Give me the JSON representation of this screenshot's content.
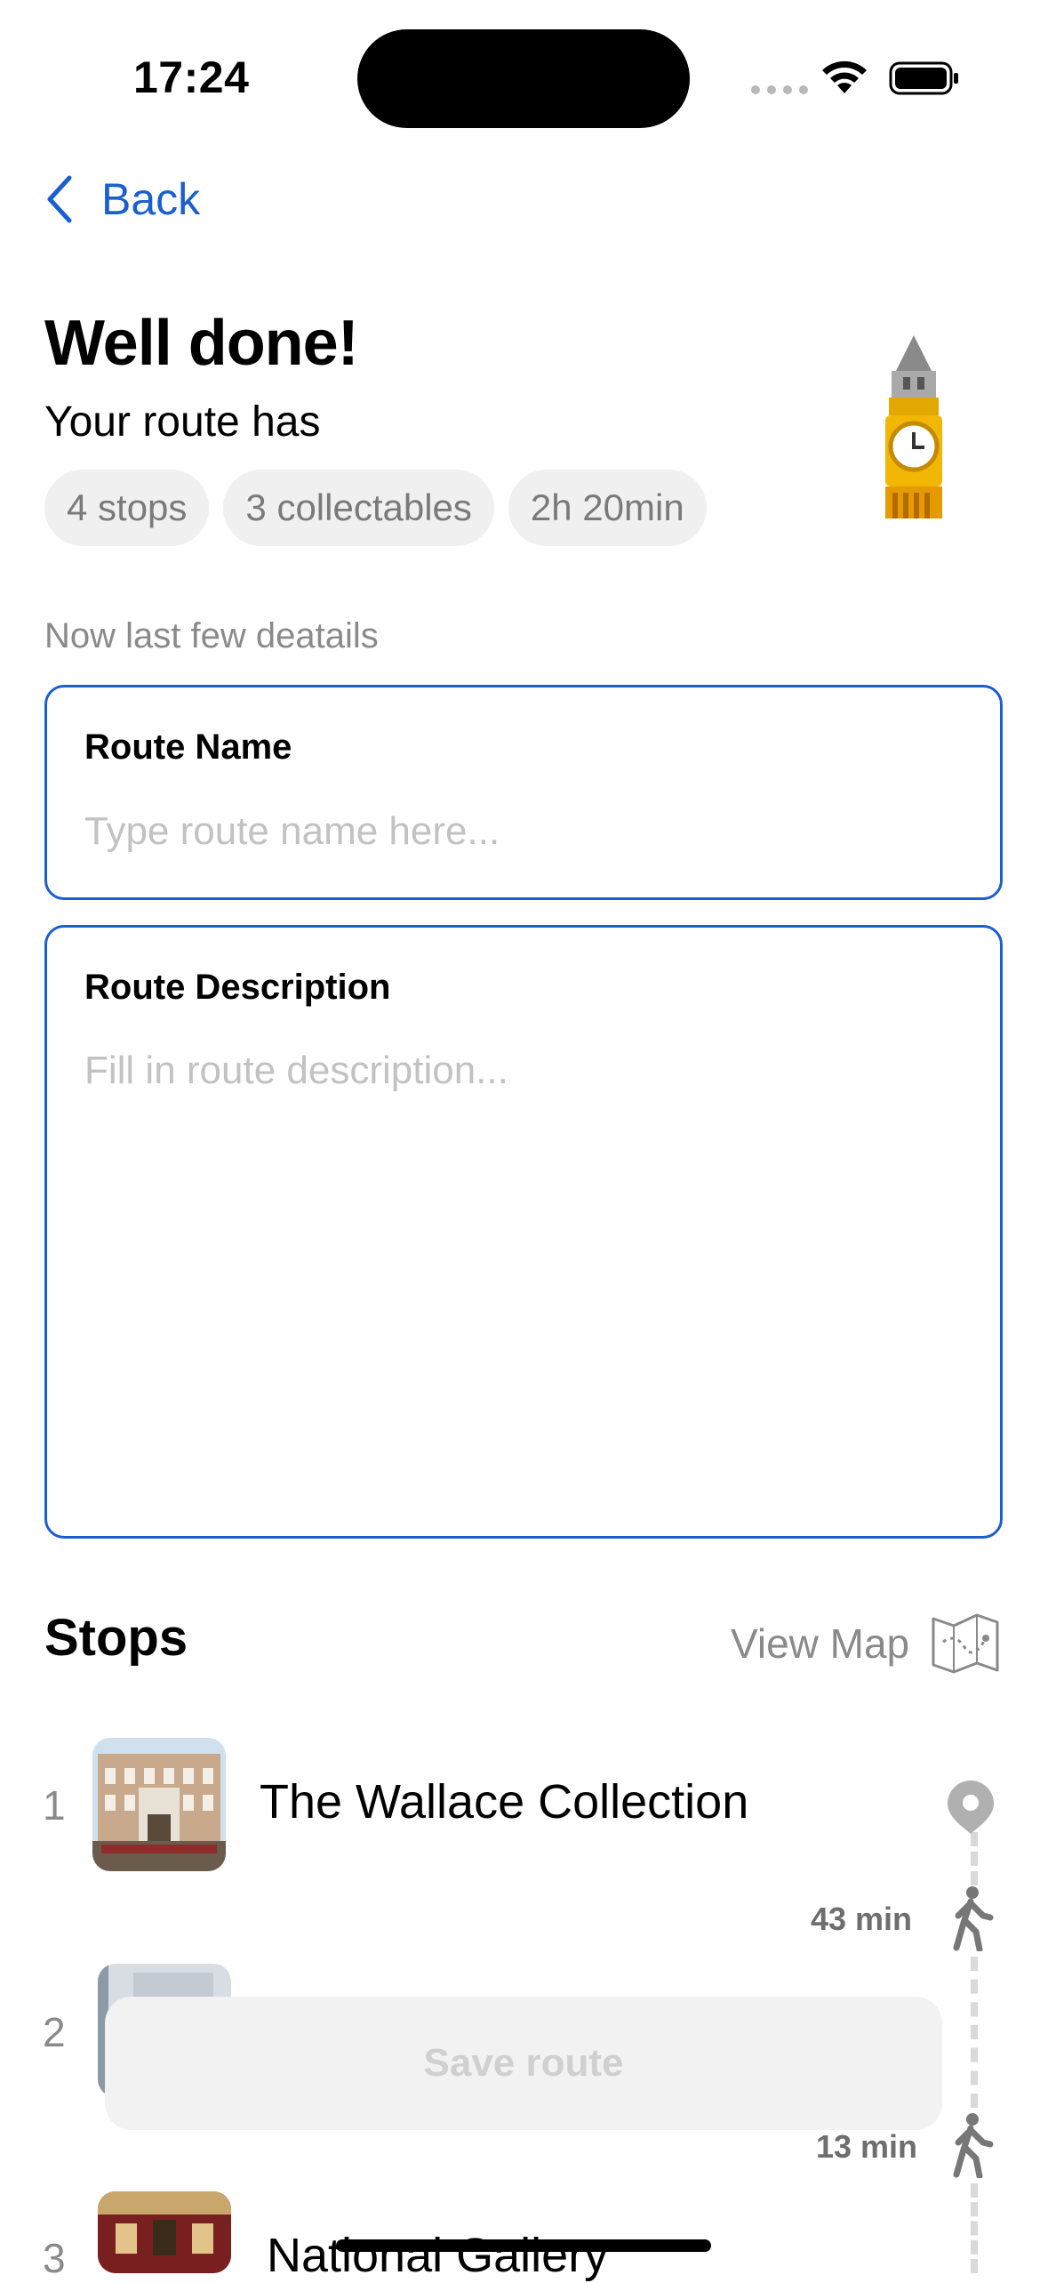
{
  "status_bar": {
    "time": "17:24"
  },
  "nav": {
    "back_label": "Back"
  },
  "header": {
    "title": "Well done!",
    "subtitle": "Your route has",
    "chips": [
      "4 stops",
      "3 collectables",
      "2h 20min"
    ],
    "badge_icon": "clock-tower-icon"
  },
  "details_note": "Now last few deatails",
  "form": {
    "name_label": "Route Name",
    "name_placeholder": "Type route name here...",
    "description_label": "Route Description",
    "description_placeholder": "Fill in route description..."
  },
  "stops": {
    "title": "Stops",
    "view_map_label": "View Map",
    "items": [
      {
        "number": "1",
        "name": "The Wallace Collection",
        "walk_after": "43 min"
      },
      {
        "number": "2",
        "name": "",
        "walk_after": "13 min"
      },
      {
        "number": "3",
        "name": "National Gallery"
      }
    ]
  },
  "actions": {
    "save_label": "Save route"
  },
  "colors": {
    "accent": "#1a5fd0",
    "chip_bg": "#f0f0f0",
    "muted_text": "#8a8a8a"
  }
}
